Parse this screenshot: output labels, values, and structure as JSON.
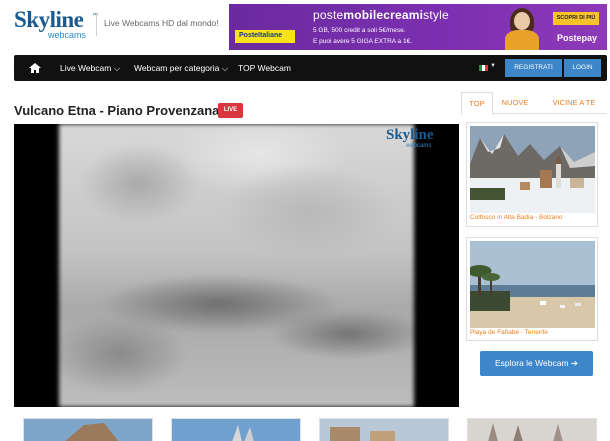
{
  "header": {
    "logo_main": "Skyline",
    "logo_sub": "webcams",
    "logo_tm": "™",
    "tagline": "Live Webcams HD dal mondo!"
  },
  "ad": {
    "brand": "PosteItaliane",
    "title_pre": "poste",
    "title_bold": "mobilecreami",
    "title_post": "style",
    "line1": "5 GB, 500 credit a soli 5€/mese.",
    "line2": "E puoi avere 5 GIGA EXTRA a 1€.",
    "cta": "SCOPRI DI PIÙ",
    "postepay": "Postepay"
  },
  "nav": {
    "home_icon": "home-icon",
    "items": [
      {
        "label": "Live Webcam ⌵"
      },
      {
        "label": "Webcam per categoria ⌵"
      },
      {
        "label": "TOP Webcam"
      }
    ],
    "flag_colors": [
      "#119447",
      "#ffffff",
      "#d9363e"
    ],
    "register_label": "REGISTRATI",
    "login_label": "LOGIN"
  },
  "main": {
    "title": "Vulcano Etna - Piano Provenzana",
    "live_badge": "LIVE",
    "watermark_main": "Skyline",
    "watermark_sub": "webcams"
  },
  "sidebar": {
    "tabs": [
      {
        "label": "TOP",
        "active": true
      },
      {
        "label": "NUOVE",
        "active": false
      },
      {
        "label": "VICINE A TE",
        "active": false
      }
    ],
    "cards": [
      {
        "caption": "Colfosco in Alta Badia - Bolzano"
      },
      {
        "caption": "Playa de Fañabé - Tenerife"
      }
    ],
    "explore_label": "Esplora le Webcam ➔"
  },
  "colors": {
    "accent": "#3c86c9",
    "orange": "#f07f1a",
    "live": "#d9363e",
    "nav_bg": "#111111"
  }
}
